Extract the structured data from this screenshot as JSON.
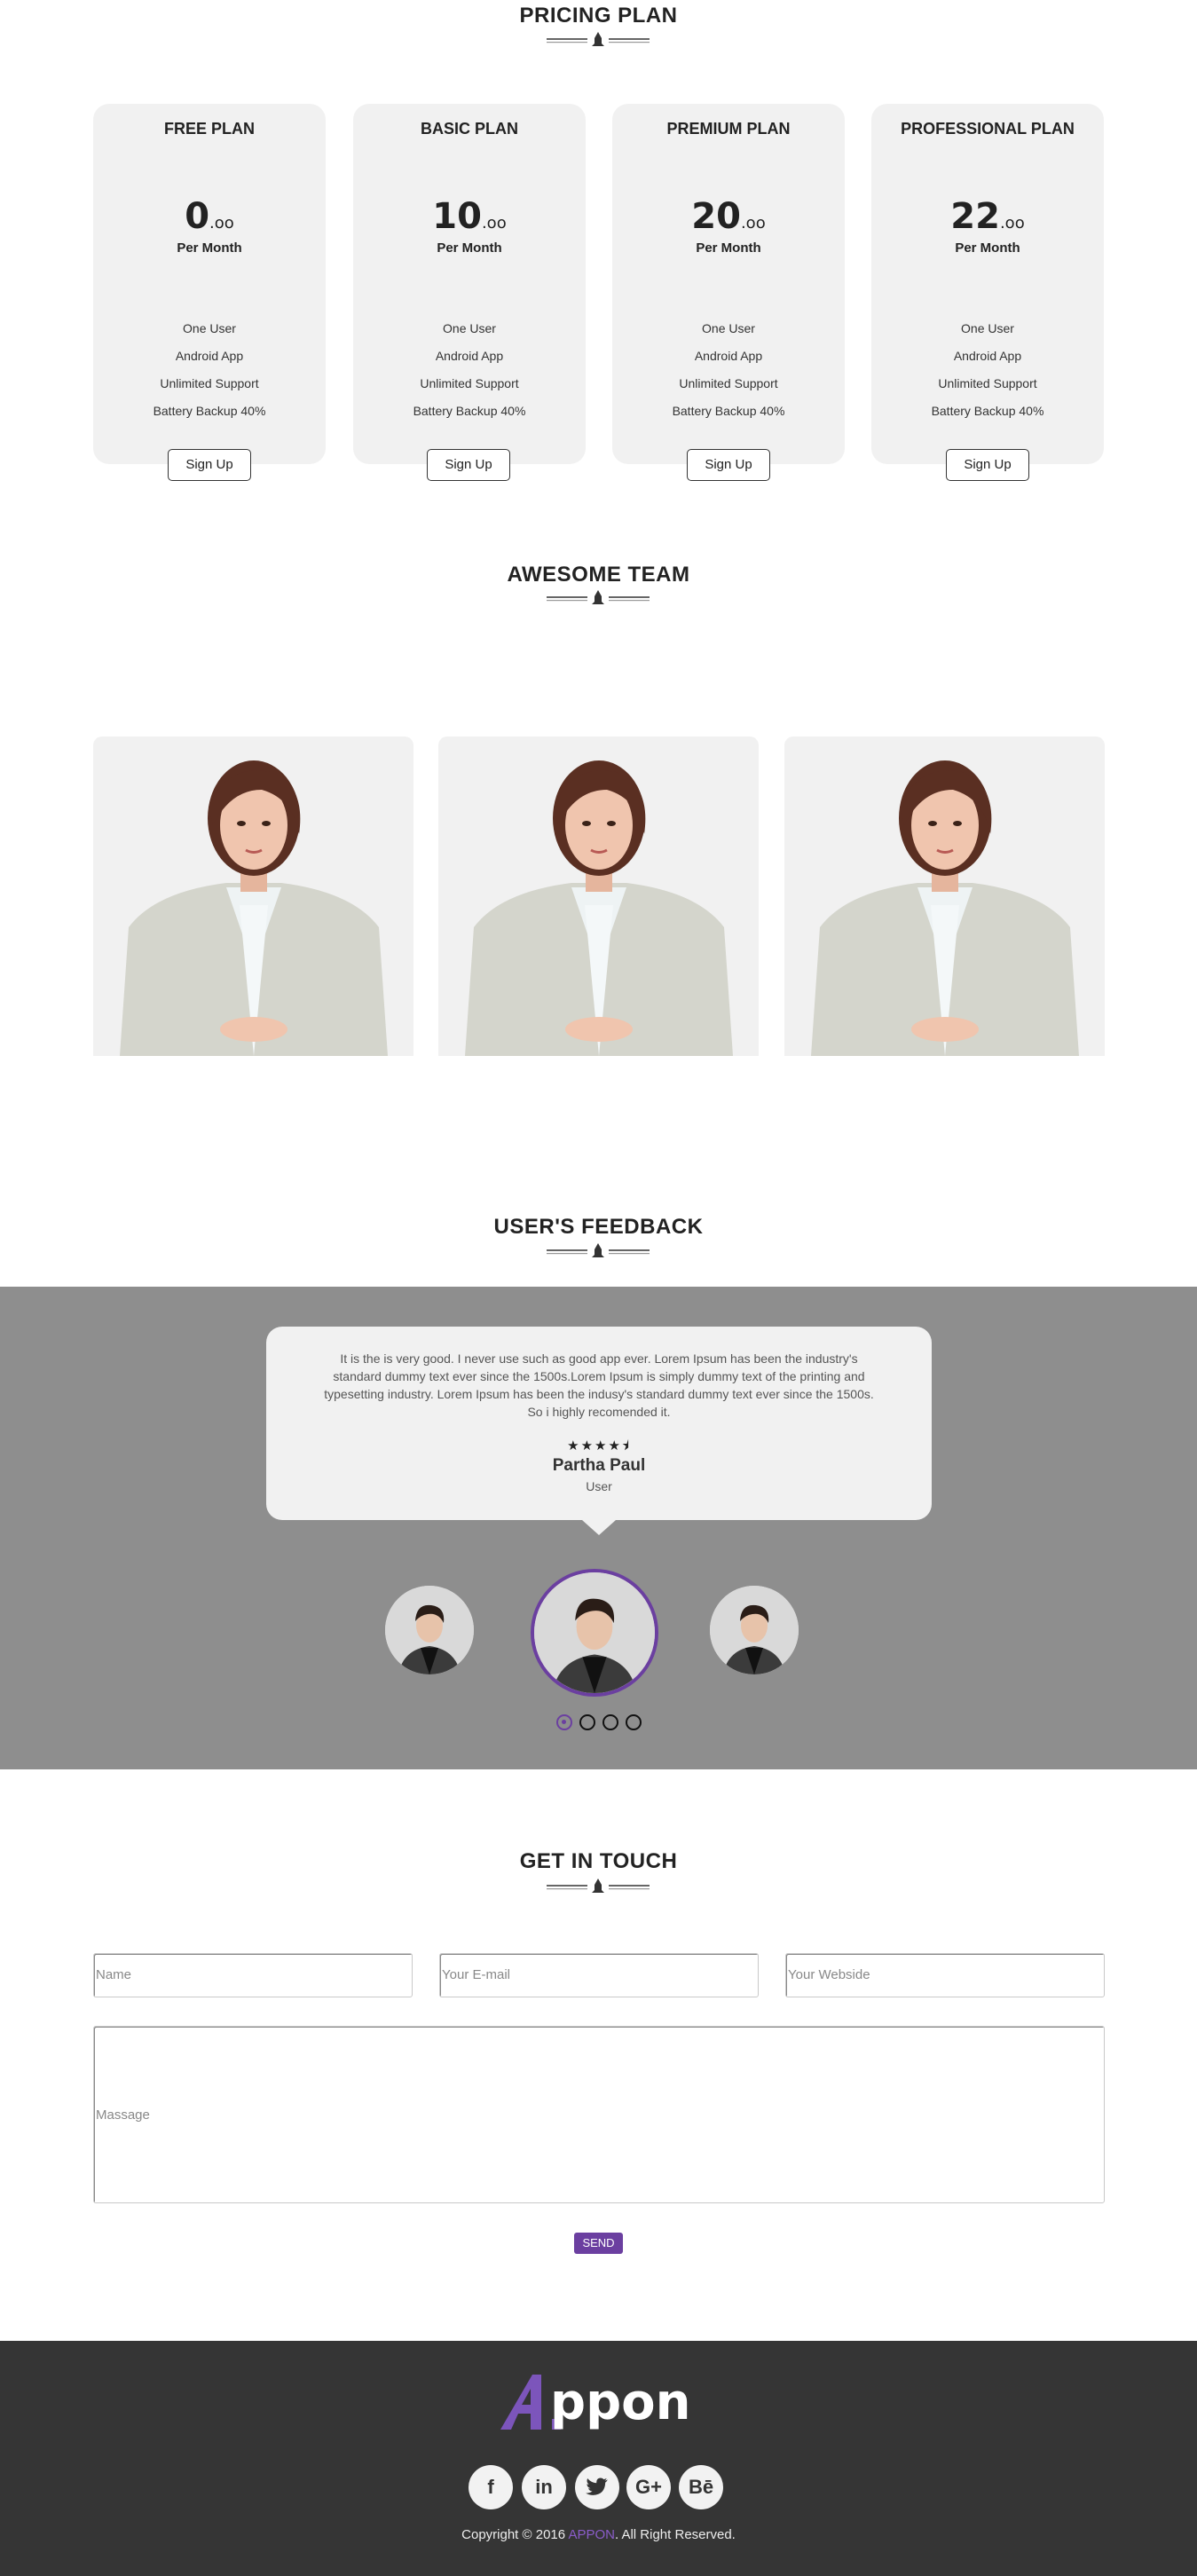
{
  "pricing": {
    "title": "PRICING PLAN",
    "plans": [
      {
        "name": "FREE PLAN",
        "price": "0",
        "cents": ".oo",
        "period": "Per Month",
        "features": [
          "One User",
          "Android App",
          "Unlimited Support",
          "Battery Backup 40%"
        ],
        "button": "Sign Up"
      },
      {
        "name": "BASIC PLAN",
        "price": "10",
        "cents": ".oo",
        "period": "Per Month",
        "features": [
          "One User",
          "Android App",
          "Unlimited Support",
          "Battery Backup 40%"
        ],
        "button": "Sign Up"
      },
      {
        "name": "PREMIUM PLAN",
        "price": "20",
        "cents": ".oo",
        "period": "Per Month",
        "features": [
          "One User",
          "Android App",
          "Unlimited Support",
          "Battery Backup 40%"
        ],
        "button": "Sign Up"
      },
      {
        "name": "PROFESSIONAL PLAN",
        "price": "22",
        "cents": ".oo",
        "period": "Per Month",
        "features": [
          "One User",
          "Android App",
          "Unlimited Support",
          "Battery Backup 40%"
        ],
        "button": "Sign Up"
      }
    ]
  },
  "team": {
    "title": "AWESOME TEAM"
  },
  "feedback": {
    "title": "USER'S FEEDBACK",
    "quote": "It is the is very good. I never use such as good app ever. Lorem Ipsum has been the industry's standard dummy text ever since the 1500s.Lorem Ipsum is simply dummy text of the printing and typesetting industry. Lorem Ipsum has been the indusy's standard dummy text ever since the 1500s. So i highly recomended it.",
    "stars": "★★★★⯨",
    "rating": 4.5,
    "name": "Partha Paul",
    "role": "User",
    "active_slide": 1
  },
  "contact": {
    "title": "GET IN TOUCH",
    "name_placeholder": "Name",
    "email_placeholder": "Your E-mail",
    "website_placeholder": "Your Webside",
    "message_placeholder": "Massage",
    "send_label": "SEND"
  },
  "footer": {
    "logo_text": "ppon",
    "social": [
      {
        "icon": "facebook-icon",
        "glyph": "f"
      },
      {
        "icon": "linkedin-icon",
        "glyph": "in"
      },
      {
        "icon": "twitter-icon",
        "glyph": "t"
      },
      {
        "icon": "google-plus-icon",
        "glyph": "G+"
      },
      {
        "icon": "behance-icon",
        "glyph": "Bē"
      }
    ],
    "copyright_prefix": "Copyright © 2016 ",
    "copyright_brand": "APPON",
    "copyright_suffix": ". All Right Reserved."
  },
  "colors": {
    "accent": "#6b3fa0",
    "card_bg": "#f1f1f1",
    "feedback_bg": "#8e8e8e",
    "footer_bg": "#353535"
  }
}
